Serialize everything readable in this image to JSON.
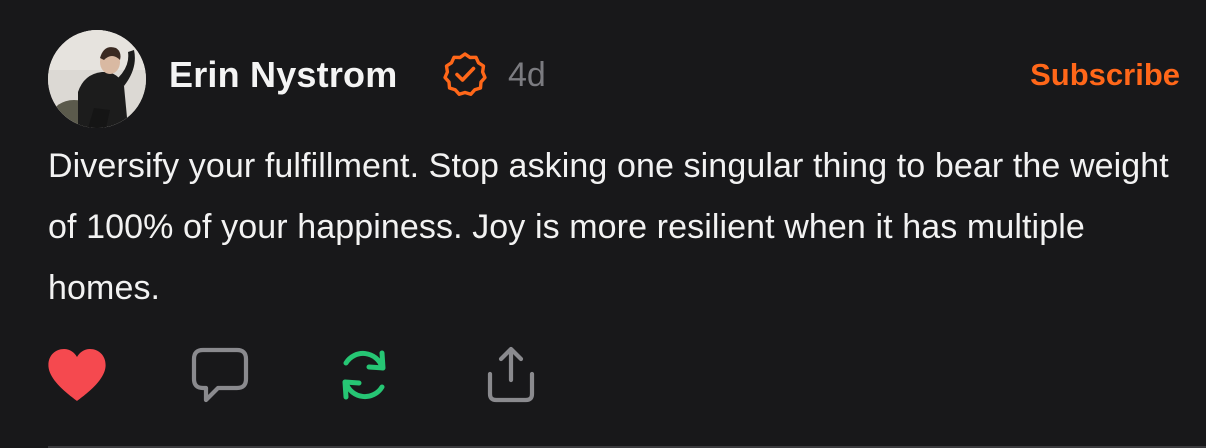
{
  "post": {
    "author": {
      "name": "Erin Nystrom",
      "verified_icon": "verified-badge-icon",
      "avatar": "avatar"
    },
    "timestamp": "4d",
    "subscribe_label": "Subscribe",
    "text": "Diversify your fulfillment. Stop asking one singular thing to bear the weight of 100% of your happiness. Joy is more resilient when it has multiple homes.",
    "actions": {
      "like": {
        "icon": "heart-icon",
        "liked": true,
        "color": "#f5494f"
      },
      "reply": {
        "icon": "comment-icon"
      },
      "restack": {
        "icon": "restack-icon",
        "color": "#26c674"
      },
      "share": {
        "icon": "share-icon"
      }
    }
  },
  "colors": {
    "background": "#18181a",
    "accent": "#ff6719",
    "muted": "#7b7b80",
    "icon_gray": "#8a8a8e"
  }
}
